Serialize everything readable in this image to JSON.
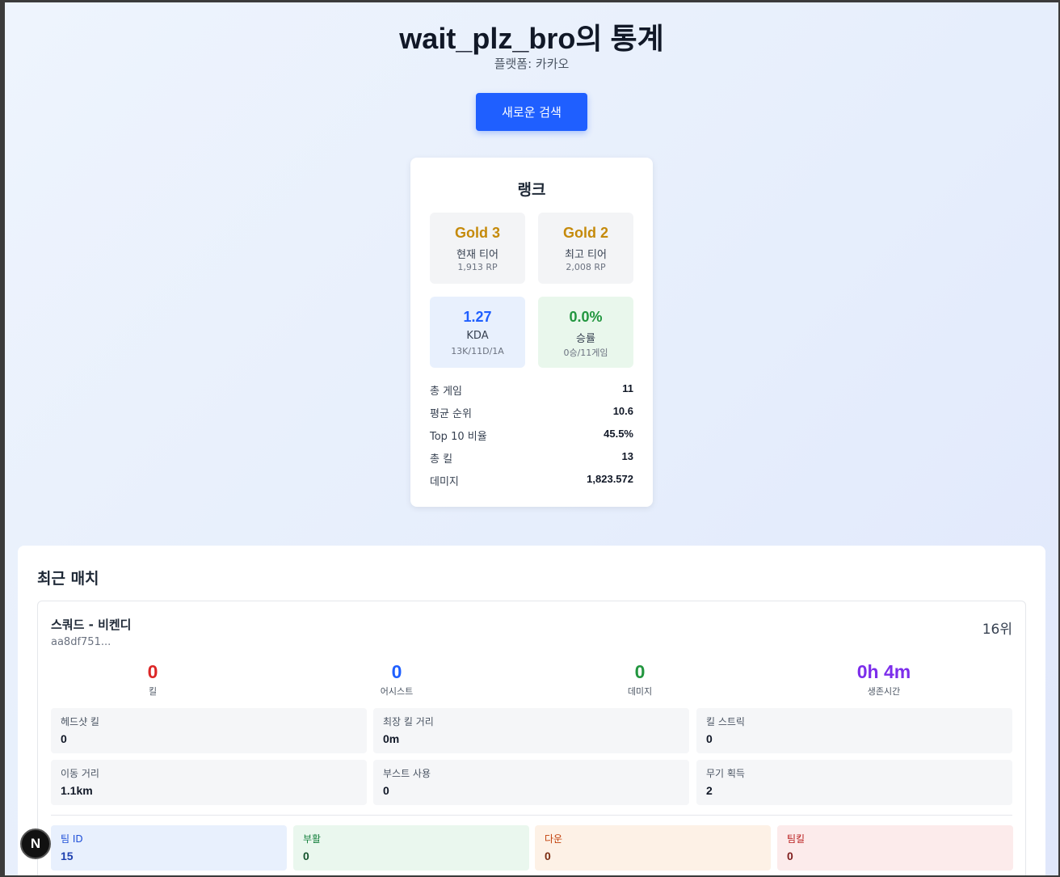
{
  "header": {
    "title": "wait_plz_bro의 통계",
    "platform": "플랫폼: 카카오",
    "new_search_label": "새로운 검색"
  },
  "rank": {
    "title": "랭크",
    "current": {
      "tier": "Gold 3",
      "label": "현재 티어",
      "rp": "1,913 RP"
    },
    "best": {
      "tier": "Gold 2",
      "label": "최고 티어",
      "rp": "2,008 RP"
    },
    "kda": {
      "value": "1.27",
      "label": "KDA",
      "detail": "13K/11D/1A"
    },
    "winrate": {
      "value": "0.0%",
      "label": "승률",
      "detail": "0승/11게임"
    },
    "stats": [
      {
        "label": "총 게임",
        "value": "11"
      },
      {
        "label": "평균 순위",
        "value": "10.6"
      },
      {
        "label": "Top 10 비율",
        "value": "45.5%"
      },
      {
        "label": "총 킬",
        "value": "13"
      },
      {
        "label": "데미지",
        "value": "1,823.572"
      }
    ]
  },
  "recent": {
    "title": "최근 매치",
    "match": {
      "mode": "스쿼드 - 비켄디",
      "id": "aa8df751...",
      "placement": "16위",
      "kills": {
        "value": "0",
        "label": "킬"
      },
      "assists": {
        "value": "0",
        "label": "어시스트"
      },
      "damage": {
        "value": "0",
        "label": "데미지"
      },
      "survival": {
        "value": "0h 4m",
        "label": "생존시간"
      },
      "details": [
        {
          "label": "헤드샷 킬",
          "value": "0"
        },
        {
          "label": "최장 킬 거리",
          "value": "0m"
        },
        {
          "label": "킬 스트릭",
          "value": "0"
        },
        {
          "label": "이동 거리",
          "value": "1.1km"
        },
        {
          "label": "부스트 사용",
          "value": "0"
        },
        {
          "label": "무기 획득",
          "value": "2"
        }
      ],
      "team": [
        {
          "label": "팀 ID",
          "value": "15"
        },
        {
          "label": "부활",
          "value": "0"
        },
        {
          "label": "다운",
          "value": "0"
        },
        {
          "label": "팀킬",
          "value": "0"
        }
      ]
    }
  },
  "badge": {
    "letter": "N"
  }
}
